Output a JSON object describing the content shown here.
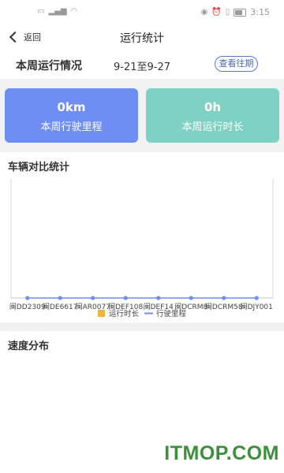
{
  "status_bar": {
    "left_icons": [
      "sim-icon",
      "signal-icon",
      "wifi-icon"
    ],
    "right_icons": [
      "eye-icon",
      "alarm-icon",
      "vibrate-icon",
      "battery-icon"
    ],
    "time": "3:15"
  },
  "nav": {
    "back_label": "返回",
    "title": "运行统计"
  },
  "week": {
    "label": "本周运行情况",
    "range": "9-21至9-27",
    "history_button": "查看往期"
  },
  "cards": [
    {
      "value": "0km",
      "label": "本周行驶里程",
      "color": "#6f8ef3"
    },
    {
      "value": "0h",
      "label": "本周运行时长",
      "color": "#7fd1c4"
    }
  ],
  "comparison": {
    "title": "车辆对比统计"
  },
  "chart_data": {
    "type": "bar",
    "categories": [
      "闽DD2309",
      "闽DE6617",
      "闽AR0077",
      "闽DEF108",
      "闽DEF14",
      "闽DCRM8",
      "闽DCRM58",
      "闽DJY001"
    ],
    "series": [
      {
        "name": "运行时长",
        "type": "bar",
        "color": "#f0b43c",
        "values": [
          0,
          0,
          0,
          0,
          0,
          0,
          0,
          0
        ]
      },
      {
        "name": "行驶里程",
        "type": "line",
        "color": "#6f8ef3",
        "values": [
          0,
          0,
          0,
          0,
          0,
          0,
          0,
          0
        ]
      }
    ],
    "legend_position": "bottom-center",
    "grid": false
  },
  "speed": {
    "title": "速度分布"
  },
  "watermark": "ITMOP.COM"
}
